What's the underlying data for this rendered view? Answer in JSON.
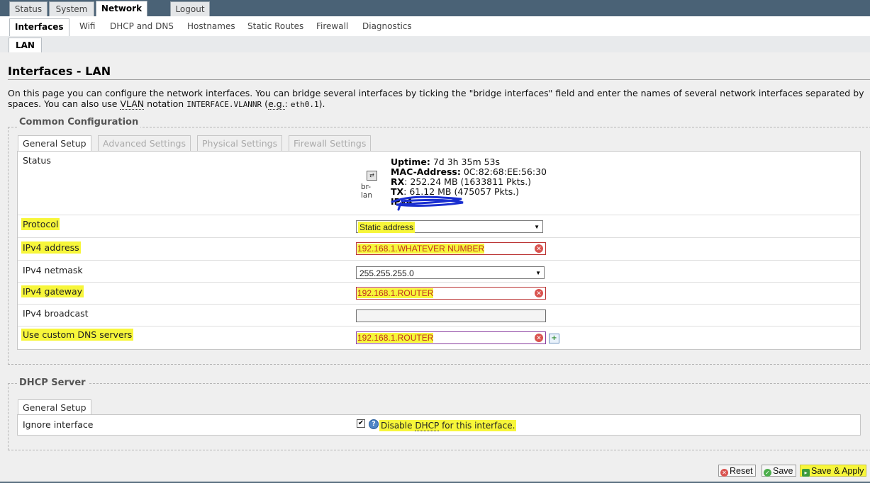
{
  "top_tabs": [
    {
      "label": "Status",
      "active": false
    },
    {
      "label": "System",
      "active": false
    },
    {
      "label": "Network",
      "active": true
    },
    {
      "label": "Logout",
      "active": false
    }
  ],
  "sub_tabs": [
    "Interfaces",
    "Wifi",
    "DHCP and DNS",
    "Hostnames",
    "Static Routes",
    "Firewall",
    "Diagnostics"
  ],
  "third_tab": "LAN",
  "page_title": "Interfaces - LAN",
  "description": {
    "line1": "On this page you can configure the network interfaces. You can bridge several interfaces by ticking the \"bridge interfaces\" field and enter the names of several network interfaces separated by",
    "line2_a": "spaces. You can also use",
    "vlan": "VLAN",
    "line2_b": "notation",
    "code1": "INTERFACE.VLANNR",
    "paren_open": "(",
    "eg": "e.g.",
    "colon": ":",
    "code2": "eth0.1",
    "paren_close": ")."
  },
  "common": {
    "legend": "Common Configuration",
    "tabs": [
      {
        "label": "General Setup",
        "active": true
      },
      {
        "label": "Advanced Settings",
        "active": false
      },
      {
        "label": "Physical Settings",
        "active": false
      },
      {
        "label": "Firewall Settings",
        "active": false
      }
    ],
    "status": {
      "label": "Status",
      "device": "br-lan",
      "uptime_label": "Uptime:",
      "uptime": "7d 3h 35m 53s",
      "mac_label": "MAC-Address:",
      "mac": "0C:82:68:EE:56:30",
      "rx_label": "RX",
      "rx": ": 252.24 MB (1633811 Pkts.)",
      "tx_label": "TX",
      "tx": ": 61.12 MB (475057 Pkts.)",
      "ipv4_label": "IPv4:"
    },
    "fields": {
      "protocol": {
        "label": "Protocol",
        "value": "Static address"
      },
      "ipv4_address": {
        "label": "IPv4 address",
        "value": "192.168.1.WHATEVER NUMBER"
      },
      "ipv4_netmask": {
        "label": "IPv4 netmask",
        "value": "255.255.255.0"
      },
      "ipv4_gateway": {
        "label": "IPv4 gateway",
        "value": "192.168.1.ROUTER"
      },
      "ipv4_broadcast": {
        "label": "IPv4 broadcast",
        "value": ""
      },
      "custom_dns": {
        "label": "Use custom DNS servers",
        "value": "192.168.1.ROUTER"
      }
    }
  },
  "dhcp": {
    "legend": "DHCP Server",
    "tab": "General Setup",
    "ignore_label": "Ignore interface",
    "checked": true,
    "help_a": "Disable",
    "help_dhcp": "DHCP",
    "help_b": "for this interface."
  },
  "buttons": {
    "reset": "Reset",
    "save": "Save",
    "save_apply": "Save & Apply"
  },
  "icons": [
    "device-icon",
    "clear-icon",
    "add-icon",
    "help-icon",
    "reset-icon",
    "save-icon",
    "apply-icon"
  ],
  "colors": {
    "highlight": "#f7f63a",
    "scribble": "#1a2fd0",
    "error_text": "#c03020"
  }
}
